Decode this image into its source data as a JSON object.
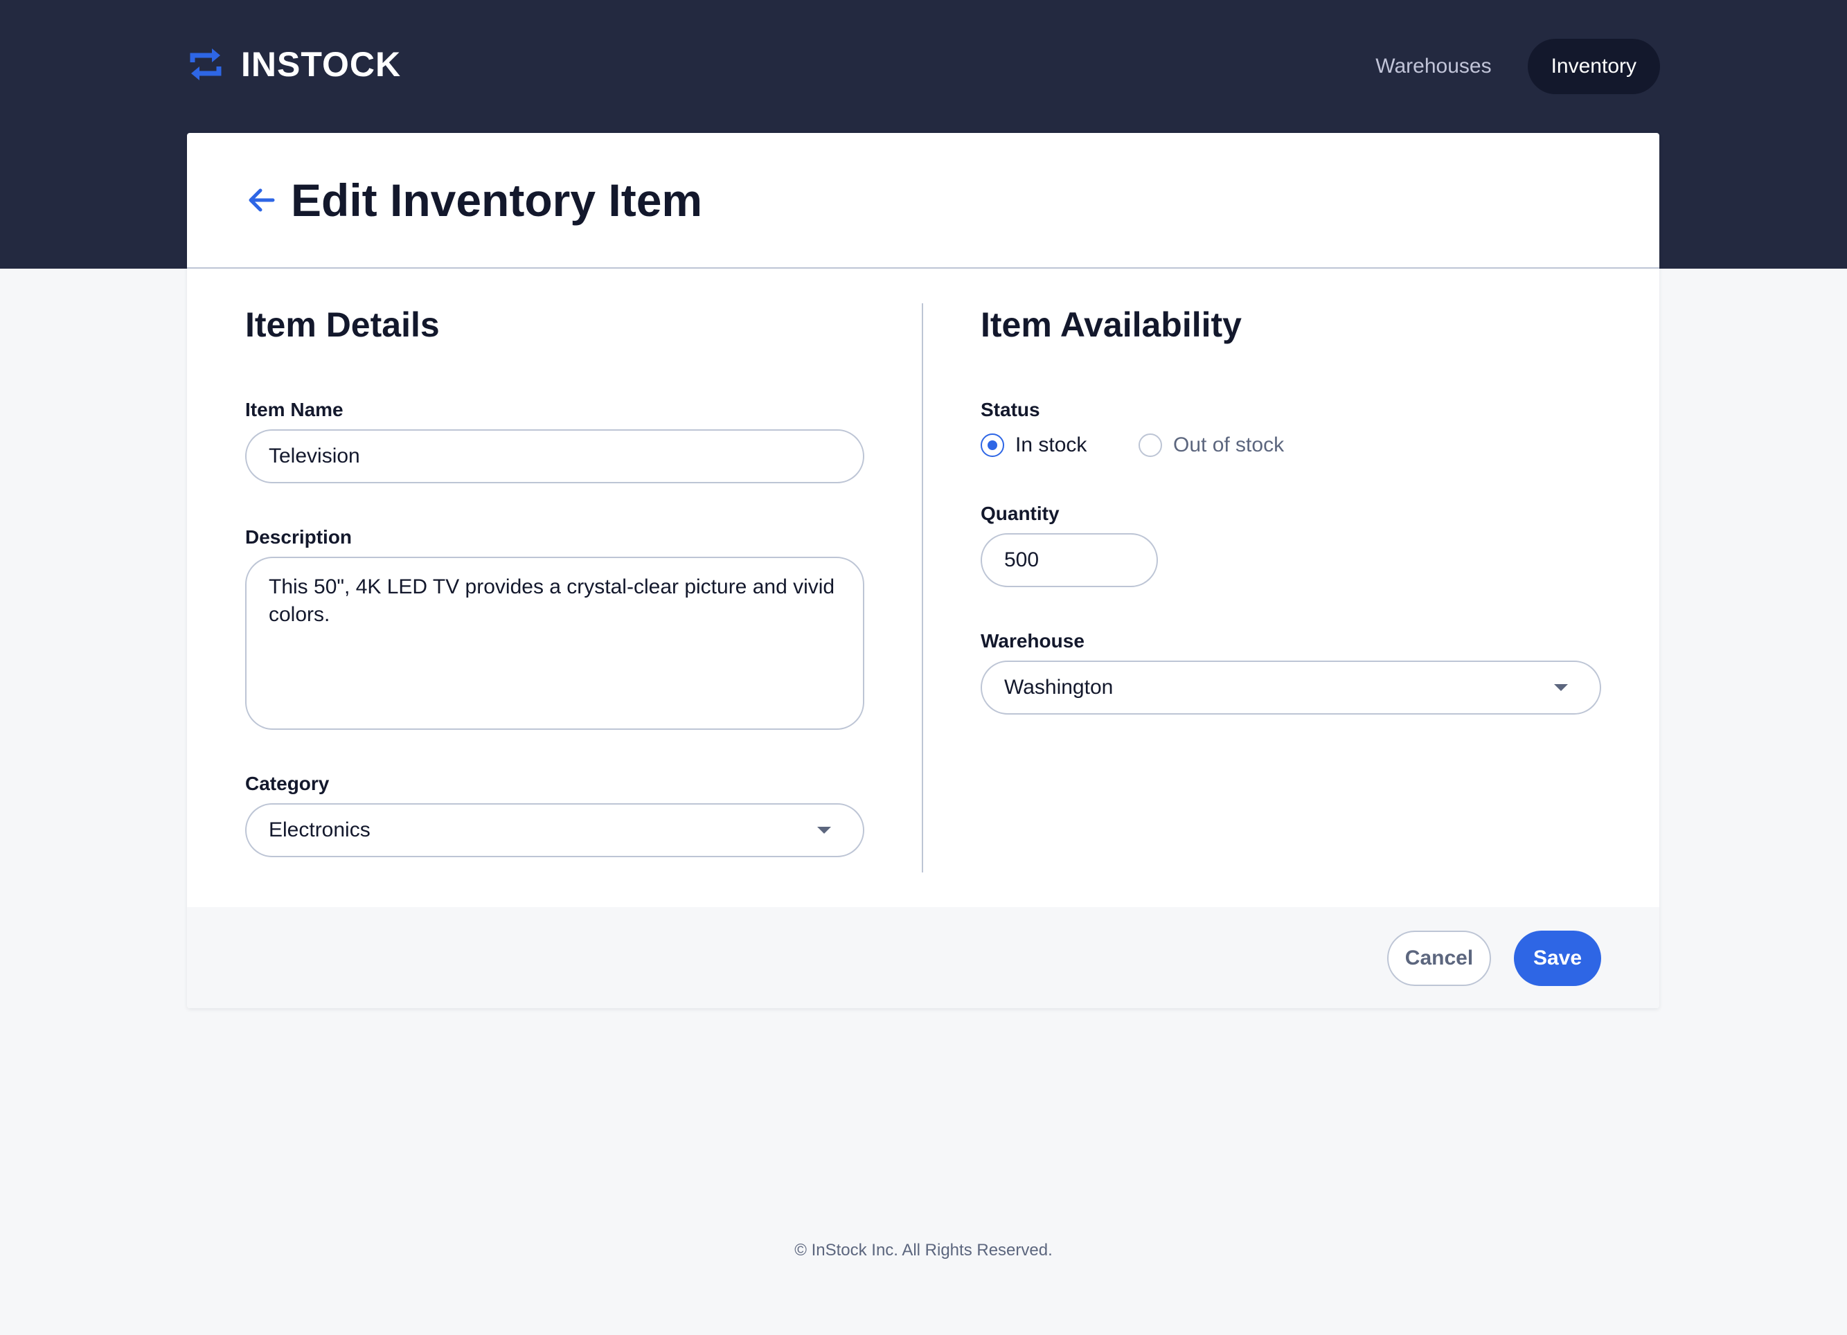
{
  "app": {
    "brand": "INSTOCK"
  },
  "nav": {
    "items": [
      {
        "label": "Warehouses",
        "active": false
      },
      {
        "label": "Inventory",
        "active": true
      }
    ]
  },
  "page": {
    "title": "Edit Inventory Item"
  },
  "item_details": {
    "section_title": "Item Details",
    "item_name": {
      "label": "Item Name",
      "value": "Television"
    },
    "description": {
      "label": "Description",
      "value": "This 50\", 4K LED TV provides a crystal-clear picture and vivid colors."
    },
    "category": {
      "label": "Category",
      "value": "Electronics"
    }
  },
  "item_availability": {
    "section_title": "Item Availability",
    "status": {
      "label": "Status",
      "options": [
        {
          "label": "In stock",
          "selected": true
        },
        {
          "label": "Out of stock",
          "selected": false
        }
      ]
    },
    "quantity": {
      "label": "Quantity",
      "value": "500"
    },
    "warehouse": {
      "label": "Warehouse",
      "value": "Washington"
    }
  },
  "actions": {
    "cancel_label": "Cancel",
    "save_label": "Save"
  },
  "footer": {
    "copyright": "© InStock Inc. All Rights Reserved."
  },
  "colors": {
    "header_bg": "#232940",
    "accent": "#2e66e5",
    "text_dark": "#13182c",
    "text_muted": "#5c667e",
    "border": "#bdc5d5",
    "page_bg": "#f6f7f9"
  },
  "icons": {
    "logo": "swap-arrows-icon",
    "back": "arrow-back-icon",
    "dropdown": "chevron-down-icon"
  }
}
